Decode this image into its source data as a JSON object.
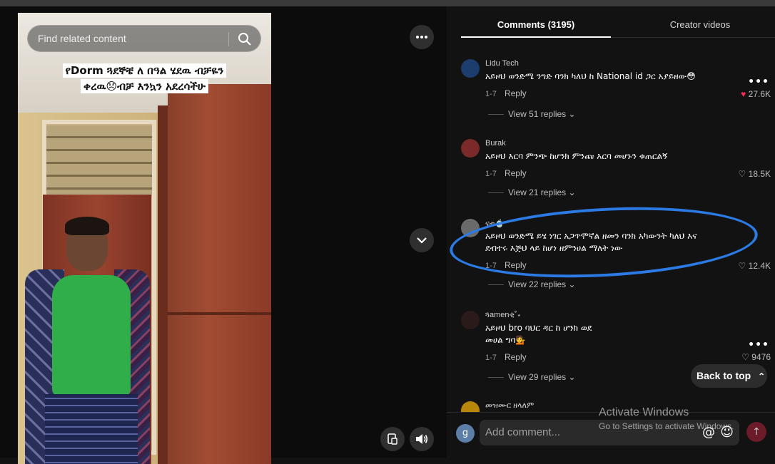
{
  "player": {
    "search_placeholder": "Find related content",
    "video_caption": "የDorm ጓደኞቼ ለ በዓል ሄደዉ ብቻዬን ቀረዉ😞ብቻ እንኳን አደረሳችሁ",
    "buttons": {
      "more": "more-icon",
      "next": "chevron-down-icon",
      "captions": "captions-icon",
      "volume": "volume-icon"
    }
  },
  "tabs": [
    {
      "label": "Comments (3195)",
      "active": true
    },
    {
      "label": "Creator videos",
      "active": false
    }
  ],
  "comments": [
    {
      "user": "Lidu Tech",
      "text": "አይዞህ ወንድሜ ንግድ ባንክ ካለህ ከ National id ጋር አያይዘው😳",
      "date": "1-7",
      "reply_label": "Reply",
      "likes": "27.6K",
      "liked": true,
      "view_replies": "View 51 replies"
    },
    {
      "user": "Burak",
      "text": "አይዞህ እርባ ምንጭ ከሆንክ ምንጩ እርባ መሆኑን ቁጠርልኝ",
      "date": "1-7",
      "reply_label": "Reply",
      "likes": "18.5K",
      "liked": false,
      "view_replies": "View 21 replies"
    },
    {
      "user": "ናቲ🍵",
      "text": "አይዞህ ወንድሜ ይሄ ነገር አጋጥሞኛል ዘመን ባንክ አካውንት ካለህ እና ደብተሩ እጅህ ላይ ከሆነ ዘምንሀል ማለት ነው",
      "date": "1-7",
      "reply_label": "Reply",
      "likes": "12.4K",
      "liked": false,
      "view_replies": "View 22 replies"
    },
    {
      "user": "ጓamenቂ˚⋆",
      "text": "አይዞህ bro ባህር ዳር ከ ሆንክ ወደ መሀል ግባ💁",
      "date": "1-7",
      "reply_label": "Reply",
      "likes": "9476",
      "liked": false,
      "view_replies": "View 29 replies"
    },
    {
      "user": "መዝሙር ዘላለም"
    }
  ],
  "back_to_top": "Back to top",
  "composer": {
    "avatar_letter": "g",
    "placeholder": "Add comment...",
    "mention_icon": "@",
    "emoji_icon": "☺",
    "send_icon": "↑"
  },
  "watermark": {
    "line1": "Activate Windows",
    "line2": "Go to Settings to activate Windows."
  },
  "colors": {
    "accent_like": "#fe2c55",
    "annotation": "#2c7be5"
  }
}
